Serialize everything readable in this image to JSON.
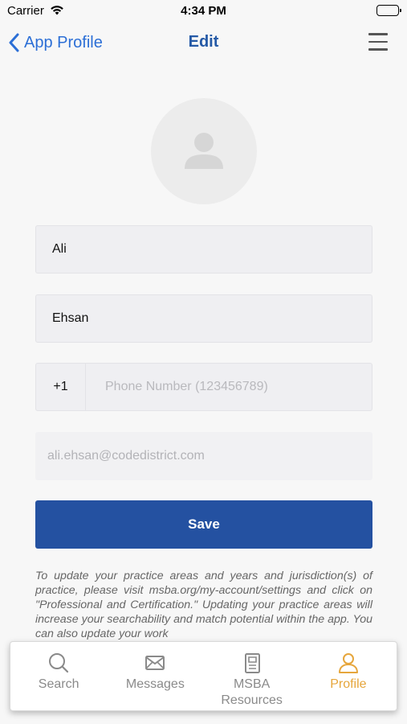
{
  "status_bar": {
    "carrier": "Carrier",
    "time": "4:34 PM"
  },
  "nav": {
    "back_label": "App Profile",
    "title": "Edit"
  },
  "form": {
    "first_name": "Ali",
    "last_name": "Ehsan",
    "country_code": "+1",
    "phone_value": "",
    "phone_placeholder": "Phone Number (123456789)",
    "email_value": "ali.ehsan@codedistrict.com"
  },
  "save_label": "Save",
  "info_text": "To update your practice areas and years and jurisdiction(s) of practice, please visit msba.org/my-account/settings and click on \"Professional and Certification.\" Updating your practice areas will increase your searchability and match potential within the app. You can also update your work",
  "tabs": [
    {
      "label": "Search",
      "icon": "search-icon",
      "active": false
    },
    {
      "label": "Messages",
      "icon": "envelope-icon",
      "active": false
    },
    {
      "label": "MSBA Resources",
      "icon": "document-icon",
      "active": false
    },
    {
      "label": "Profile",
      "icon": "person-icon",
      "active": true
    }
  ],
  "colors": {
    "accent_blue": "#2c6fd6",
    "title_blue": "#2459a6",
    "save_button": "#2451a1",
    "active_tab": "#e6a63c",
    "inactive_tab": "#8a8a8a"
  }
}
